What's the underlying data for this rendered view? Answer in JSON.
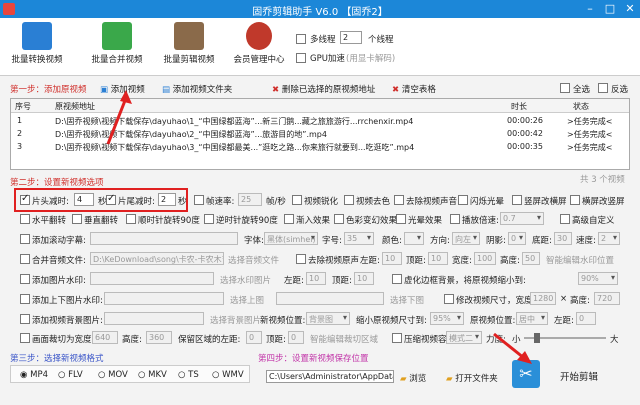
{
  "window": {
    "title": "固乔剪辑助手 V6.0 【固乔2】"
  },
  "toolbar": {
    "buttons": [
      {
        "label": "批量转换视频",
        "color": "#2a7fd4"
      },
      {
        "label": "批量合并视频",
        "color": "#3aa84a"
      },
      {
        "label": "批量剪辑视频",
        "color": "#8a6a4a"
      },
      {
        "label": "会员管理中心",
        "color": "#c0392b"
      }
    ],
    "multithread_label": "多线程",
    "threads_value": "2",
    "threads_unit": "个线程",
    "gpu_label": "GPU加速",
    "gpu_hint": "(用显卡解码)"
  },
  "step1": {
    "title": "第一步：添加原视频",
    "add_video": "添加视频",
    "add_folder": "添加视频文件夹",
    "delete_selected": "删除已选择的原视频地址",
    "clear_table": "清空表格",
    "select_all": "全选",
    "invert": "反选"
  },
  "table": {
    "headers": [
      "序号",
      "原视频地址",
      "时长",
      "状态"
    ],
    "rows": [
      {
        "no": "1",
        "path": "D:\\固乔视频\\视频下载保存\\dayuhao\\1_“中国绿都蓝海”...新三门鹅...藏之旅旅游行...rrchenxir.mp4",
        "duration": "00:00:26",
        "status": ">任务完成<"
      },
      {
        "no": "2",
        "path": "D:\\固乔视频\\视频下载保存\\dayuhao\\2_“中国绿都蓝海”...旅游目的地”.mp4",
        "duration": "00:00:42",
        "status": ">任务完成<"
      },
      {
        "no": "3",
        "path": "D:\\固乔视频\\视频下载保存\\dayuhao\\3_“中国绿都最美...”逛吃之路...你来旅行就要到...吃逛吃”.mp4",
        "duration": "00:00:35",
        "status": ">任务完成<"
      }
    ],
    "count": "共 3 个视频"
  },
  "step2": {
    "title": "第二步：设置新视频选项",
    "head_cut": {
      "label": "片头减时:",
      "value": "4",
      "unit": "秒"
    },
    "tail_cut": {
      "label": "片尾减时:",
      "value": "2",
      "unit": "秒"
    },
    "frame_rate": {
      "label": "帧速率:",
      "value": "25",
      "unit": "帧/秒"
    },
    "row1_opts": [
      "视频锐化",
      "视频去色",
      "去除视频声音",
      "闪烁光晕",
      "竖屏改横屏",
      "横屏改竖屏"
    ],
    "row2_opts": [
      "水平翻转",
      "垂直翻转",
      "顺时针旋转90度",
      "逆时针旋转90度",
      "渐入效果",
      "色彩变幻效果",
      "光晕效果"
    ],
    "speed": {
      "label": "播放倍速:",
      "value": "0.7"
    },
    "advanced_custom": "高级自定义",
    "subtitle": {
      "label": "添加滚动字幕:",
      "font_label": "字体:",
      "font": "黑体(simhei)",
      "size_label": "字号:",
      "size": "35",
      "color_label": "颜色:",
      "dir_label": "方向:",
      "dir": "向左",
      "shadow_label": "阴影:",
      "shadow": "0",
      "bottom_label": "底距:",
      "bottom": "30",
      "speed_label": "速度:",
      "speed": "2"
    },
    "audio": {
      "label": "合并音频文件:",
      "value": "D:\\KeDownload\\song\\卡农-卡农木吉他循",
      "pick": "选择音频文件",
      "remove_orig": "去除视频原声",
      "left_label": "左距:",
      "left": "10",
      "top_label": "顶距:",
      "top": "10",
      "width_label": "宽度:",
      "width": "100",
      "height_label": "高度:",
      "height": "50",
      "smart_wm": "智能编辑水印位置"
    },
    "image_wm": {
      "label": "添加图片水印:",
      "pick": "选择水印图片",
      "left_label": "左距:",
      "left": "10",
      "top_label": "顶距:",
      "top": "10",
      "blur_bg": "虚化边框背景，将原视频缩小到:",
      "scale": "90%"
    },
    "updown": {
      "label": "添加上下图片水印:",
      "pick_top": "选择上图",
      "pick_bottom": "选择下图",
      "modify_size": "修改视频尺寸，宽度:",
      "w": "1280",
      "x": "×",
      "h_label": "高度:",
      "h": "720"
    },
    "bg_image": {
      "label": "添加视频背景图片:",
      "pick": "选择背景图片",
      "pos_label": "新视频位置:",
      "pos": "背景图",
      "shrink_label": "缩小原视频尺寸到:",
      "shrink": "95%",
      "pos2_label": "原视频位置:",
      "pos2": "居中",
      "left_label": "左距:",
      "left": "0"
    },
    "crop": {
      "label": "画面裁切为宽度:",
      "w": "640",
      "h_label": "高度:",
      "h": "360",
      "keep_left": "保留区域的左距:",
      "left": "0",
      "top_label": "顶距:",
      "top": "0",
      "smart_crop": "智能编辑裁切区域",
      "compress": "压缩视频容量",
      "mode": "模式二",
      "ratio_label": "力度:",
      "small": "小",
      "big": "大"
    }
  },
  "step3": {
    "title": "第三步：选择新视频格式",
    "formats": [
      "MP4",
      "FLV",
      "MOV",
      "MKV",
      "TS",
      "WMV"
    ],
    "selected": "MP4"
  },
  "step4": {
    "title": "第四步：设置新视频保存位置",
    "path": "C:\\Users\\Administrator\\AppData\\Lo",
    "browse": "浏览",
    "open_folder": "打开文件夹",
    "start": "开始剪辑"
  }
}
